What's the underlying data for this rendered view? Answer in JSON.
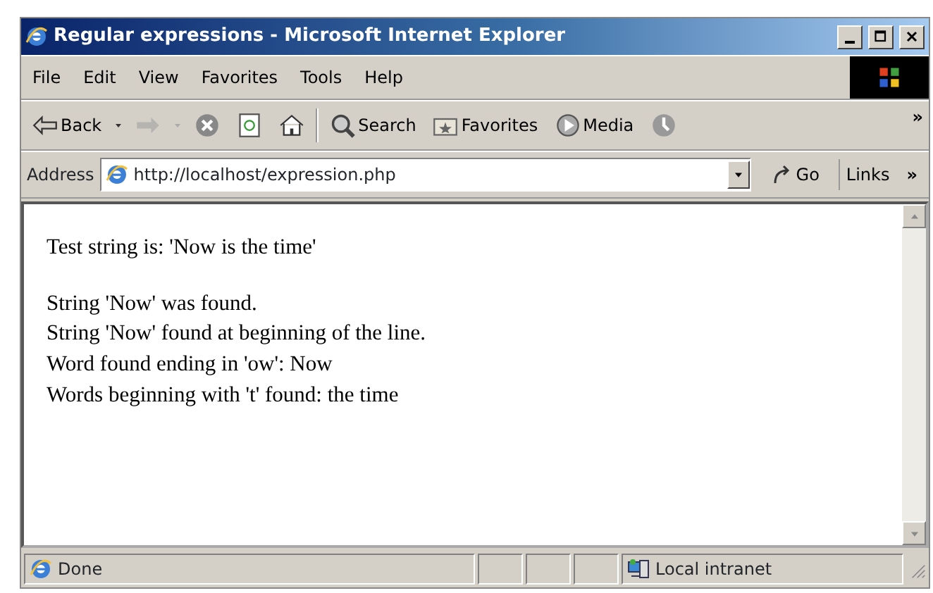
{
  "window": {
    "title": "Regular expressions - Microsoft Internet Explorer"
  },
  "menu": [
    "File",
    "Edit",
    "View",
    "Favorites",
    "Tools",
    "Help"
  ],
  "toolbar": [
    {
      "kind": "back",
      "label": "Back",
      "disabled": false
    },
    {
      "kind": "forward",
      "disabled": true
    },
    {
      "kind": "stop",
      "disabled": false
    },
    {
      "kind": "refresh",
      "disabled": false
    },
    {
      "kind": "home",
      "disabled": false
    },
    {
      "kind": "search",
      "label": "Search",
      "disabled": false
    },
    {
      "kind": "favorites",
      "label": "Favorites",
      "disabled": false
    },
    {
      "kind": "media",
      "label": "Media",
      "disabled": false
    },
    {
      "kind": "history",
      "disabled": false
    }
  ],
  "toolbar_overflow": "»",
  "address_bar": {
    "label": "Address",
    "url": "http://localhost/expression.php",
    "go": "Go",
    "links": "Links",
    "links_overflow": "»"
  },
  "content": {
    "heading": "Test string is: 'Now is the time'",
    "lines": [
      "String 'Now' was found.",
      "String 'Now' found at beginning of the line.",
      "Word found ending in 'ow': Now",
      "Words beginning with 't' found: the time"
    ]
  },
  "status_bar": {
    "text": "Done",
    "zone": "Local intranet"
  }
}
